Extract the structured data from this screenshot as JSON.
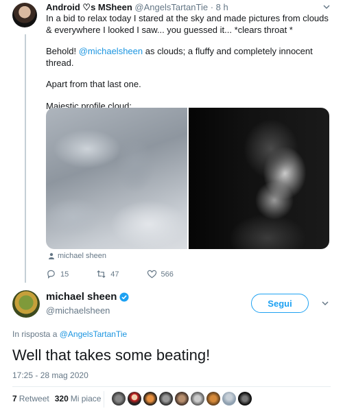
{
  "tweet1": {
    "display_name": "Android ♡s MSheen",
    "handle": "@AngelsTartanTie",
    "separator": "·",
    "time": "8 h",
    "line1": "In a bid to relax today I stared at the sky and made pictures from clouds & everywhere I looked I saw... you guessed it... *clears throat *",
    "line2_prefix": "Behold! ",
    "line2_mention": "@michaelsheen",
    "line2_suffix": " as clouds; a fluffy and completely innocent thread.",
    "line3": "Apart from that last one.",
    "line4": "Majestic profile cloud:",
    "media_tag": "michael sheen",
    "replies": "15",
    "retweets": "47",
    "likes": "566"
  },
  "tweet2": {
    "display_name": "michael sheen",
    "handle": "@michaelsheen",
    "follow_label": "Segui",
    "reply_prefix": "In risposta a ",
    "reply_handle": "@AngelsTartanTie",
    "text": "Well that takes some beating!",
    "timestamp": "17:25 - 28 mag 2020",
    "retweet_count": "7",
    "retweet_label": "Retweet",
    "like_count": "320",
    "like_label": "Mi piace"
  },
  "colors": {
    "accent": "#1da1f2",
    "link": "#1b95e0",
    "secondary_text": "#657786"
  },
  "icons": [
    "reply-icon",
    "retweet-icon",
    "like-icon",
    "verified-icon",
    "person-icon",
    "chevron-down-icon"
  ]
}
